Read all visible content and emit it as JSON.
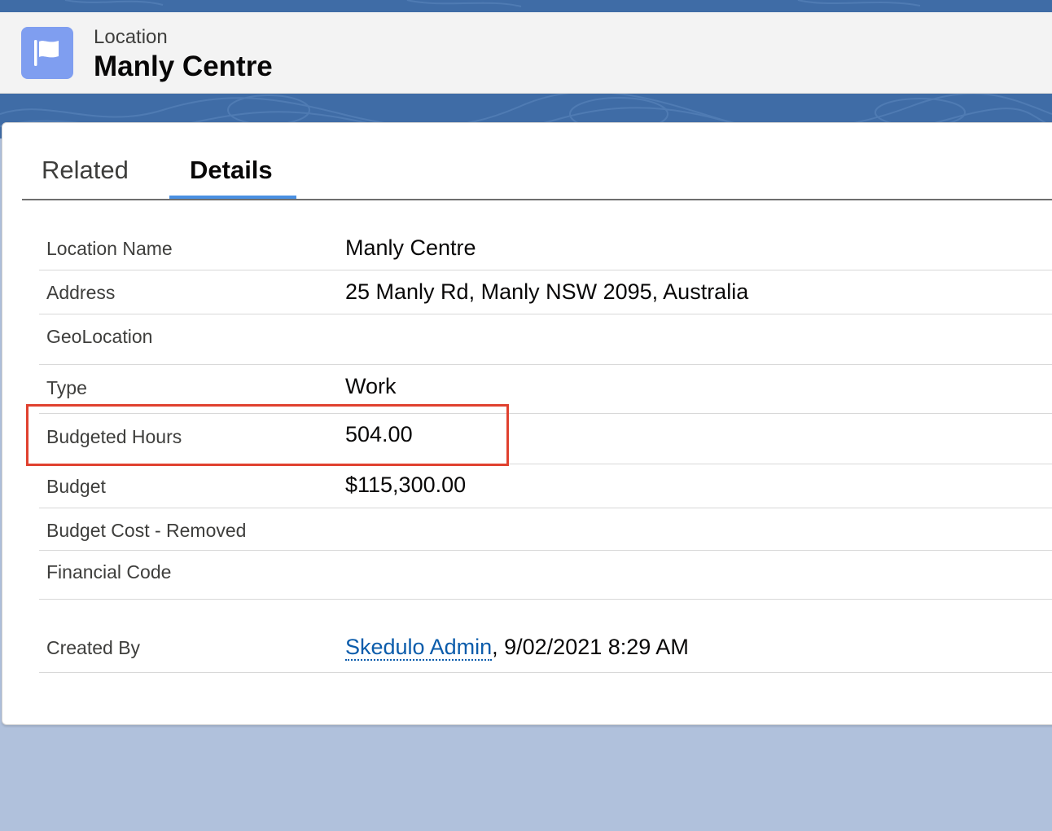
{
  "header": {
    "object_type": "Location",
    "record_title": "Manly Centre",
    "icon": "flag-icon",
    "icon_bg_color": "#7f9ef0"
  },
  "tabs": [
    {
      "label": "Related",
      "active": false
    },
    {
      "label": "Details",
      "active": true
    }
  ],
  "fields": {
    "location_name": {
      "label": "Location Name",
      "value": "Manly Centre"
    },
    "address": {
      "label": "Address",
      "value": "25 Manly Rd, Manly NSW 2095, Australia"
    },
    "geolocation": {
      "label": "GeoLocation",
      "value": ""
    },
    "type": {
      "label": "Type",
      "value": "Work"
    },
    "budgeted_hours": {
      "label": "Budgeted Hours",
      "value": "504.00"
    },
    "budget": {
      "label": "Budget",
      "value": "$115,300.00"
    },
    "budget_cost_removed": {
      "label": "Budget Cost - Removed",
      "value": ""
    },
    "financial_code": {
      "label": "Financial Code",
      "value": ""
    },
    "created_by": {
      "label": "Created By",
      "user": "Skedulo Admin",
      "timestamp": ", 9/02/2021 8:29 AM"
    }
  },
  "colors": {
    "background_band": "#3f6ca6",
    "page_background": "#b0c1dc",
    "highlight_box": "#e0412f",
    "tab_active_underline": "#4a90e2",
    "link": "#0b5cab"
  }
}
